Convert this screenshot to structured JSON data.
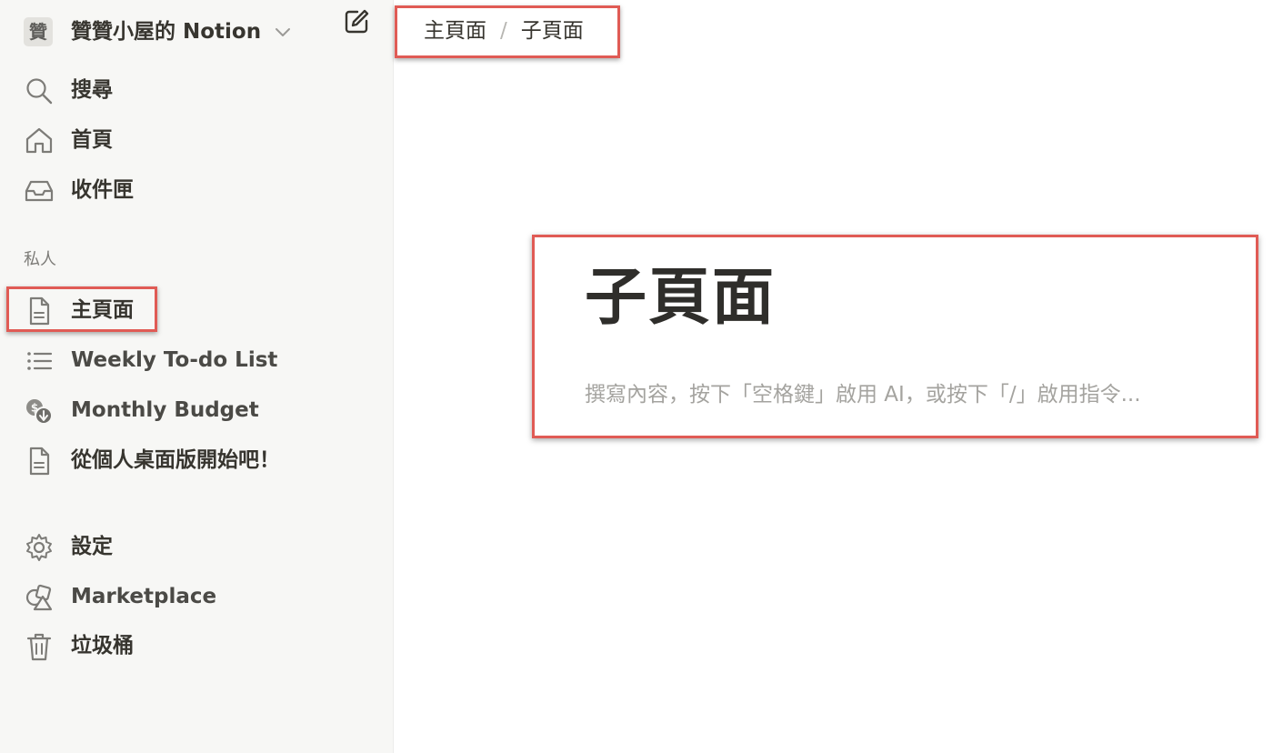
{
  "sidebar": {
    "workspace": {
      "avatar": "贊",
      "name": "贊贊小屋的 Notion"
    },
    "top_nav": [
      {
        "label": "搜尋",
        "icon": "search-icon"
      },
      {
        "label": "首頁",
        "icon": "home-icon"
      },
      {
        "label": "收件匣",
        "icon": "inbox-icon"
      }
    ],
    "section_label": "私人",
    "pages": [
      {
        "label": "主頁面",
        "icon": "page-icon"
      },
      {
        "label": "Weekly To-do List",
        "icon": "list-icon"
      },
      {
        "label": "Monthly Budget",
        "icon": "budget-icon"
      },
      {
        "label": "從個人桌面版開始吧！",
        "icon": "page-icon"
      }
    ],
    "bottom_nav": [
      {
        "label": "設定",
        "icon": "gear-icon"
      },
      {
        "label": "Marketplace",
        "icon": "marketplace-icon"
      },
      {
        "label": "垃圾桶",
        "icon": "trash-icon"
      }
    ]
  },
  "breadcrumb": {
    "parent": "主頁面",
    "separator": "/",
    "current": "子頁面"
  },
  "page": {
    "title": "子頁面",
    "placeholder": "撰寫內容，按下「空格鍵」啟用 AI，或按下「/」啟用指令..."
  },
  "colors": {
    "highlight": "#e05b55",
    "sidebar_bg": "#f7f7f5",
    "text": "#37352f",
    "placeholder": "#a4a39f"
  }
}
